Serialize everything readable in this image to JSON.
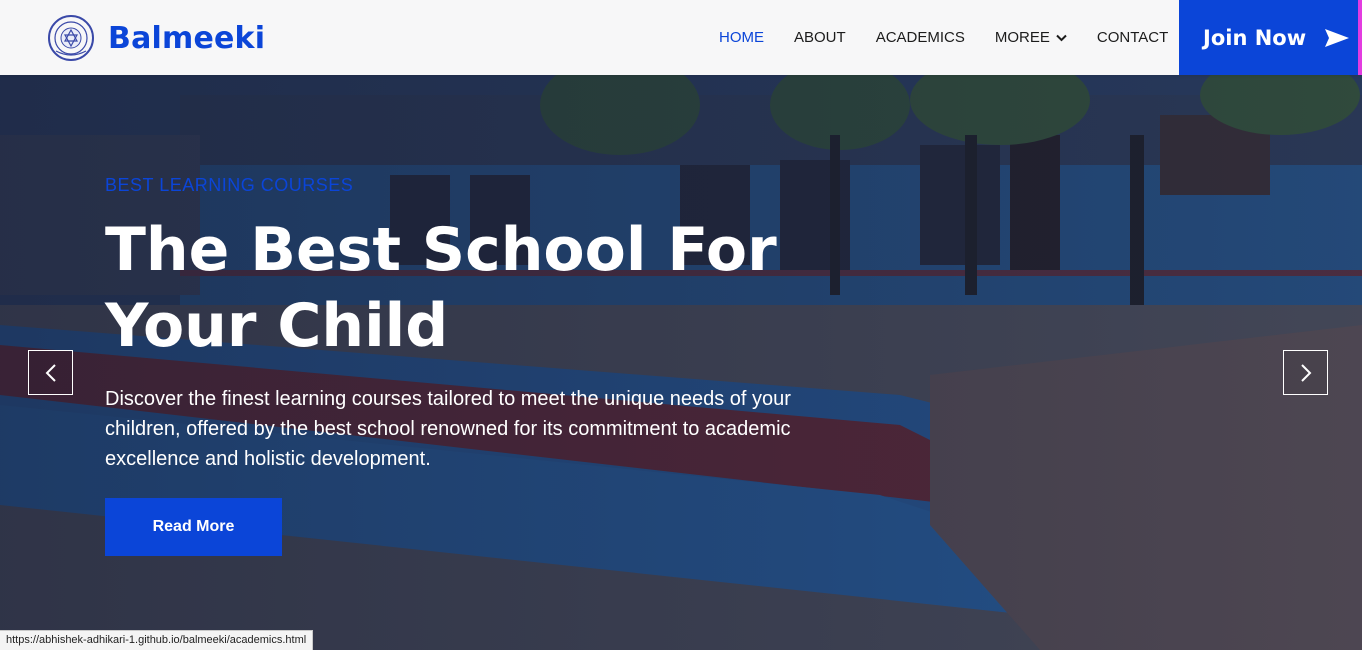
{
  "header": {
    "brand_name": "Balmeeki",
    "logo_icon": "school-emblem-icon",
    "nav": {
      "home": "HOME",
      "about": "ABOUT",
      "academics": "ACADEMICS",
      "more": "MOREE",
      "contact": "CONTACT"
    },
    "join_label": "Join Now"
  },
  "hero": {
    "eyebrow": "BEST LEARNING COURSES",
    "title_line1": "The Best School For",
    "title_line2": "Your Child",
    "description": "Discover the finest learning courses tailored to meet the unique needs of your children, offered by the best school renowned for its commitment to academic excellence and holistic development.",
    "cta_label": "Read More"
  },
  "carousel": {
    "prev_icon": "chevron-left-icon",
    "next_icon": "chevron-right-icon"
  },
  "status_bar": {
    "url": "https://abhishek-adhikari-1.github.io/balmeeki/academics.html"
  },
  "colors": {
    "brand_blue": "#0b45d8",
    "nav_bg": "#f7f7f8",
    "nav_text": "#1c1c1c",
    "edge_accent": "#e33be0"
  }
}
